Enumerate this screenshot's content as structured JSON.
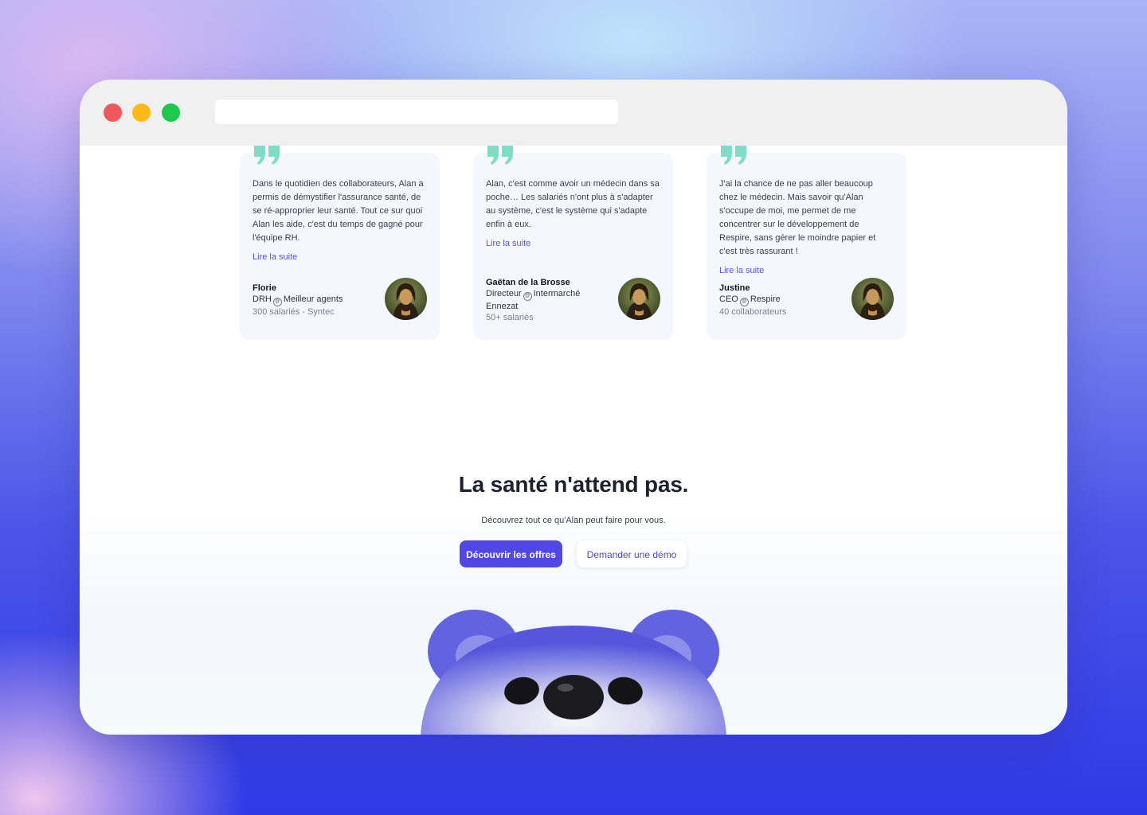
{
  "testimonials": [
    {
      "quote": "Dans le quotidien des collaborateurs, Alan a permis de démystifier l'assurance santé, de se ré-approprier leur santé. Tout ce sur quoi Alan les aide, c'est du temps de gagné pour l'équipe RH.",
      "read_more": "Lire la suite",
      "name": "Florie",
      "role": "DRH",
      "company": "Meilleur agents",
      "size": "300 salariés - Syntec"
    },
    {
      "quote": "Alan, c'est comme avoir un médecin dans sa poche… Les salariés n'ont plus à s'adapter au système, c'est le système qui s'adapte enfin à eux.",
      "read_more": "Lire la suite",
      "name": "Gaëtan de la Brosse",
      "role": "Directeur",
      "company": "Intermarché Ennezat",
      "size": "50+ salariés"
    },
    {
      "quote": "J'ai la chance de ne pas aller beaucoup chez le médecin. Mais savoir qu'Alan s'occupe de moi, me permet de me concentrer sur le développement de Respire, sans gérer le moindre papier et c'est très rassurant !",
      "read_more": "Lire la suite",
      "name": "Justine",
      "role": "CEO",
      "company": "Respire",
      "size": "40 collaborateurs"
    }
  ],
  "cta": {
    "title": "La santé n'attend pas.",
    "subtitle": "Découvrez tout ce qu'Alan peut faire pour vous.",
    "primary_button": "Découvrir les offres",
    "secondary_button": "Demander une démo"
  },
  "icons": {
    "quote": "quote-icon",
    "avatar": "mona-lisa-avatar",
    "mascot": "bear-mascot"
  },
  "colors": {
    "accent": "#5146e6",
    "link": "#5a52e4",
    "quote_mark": "#7fdcc7"
  }
}
